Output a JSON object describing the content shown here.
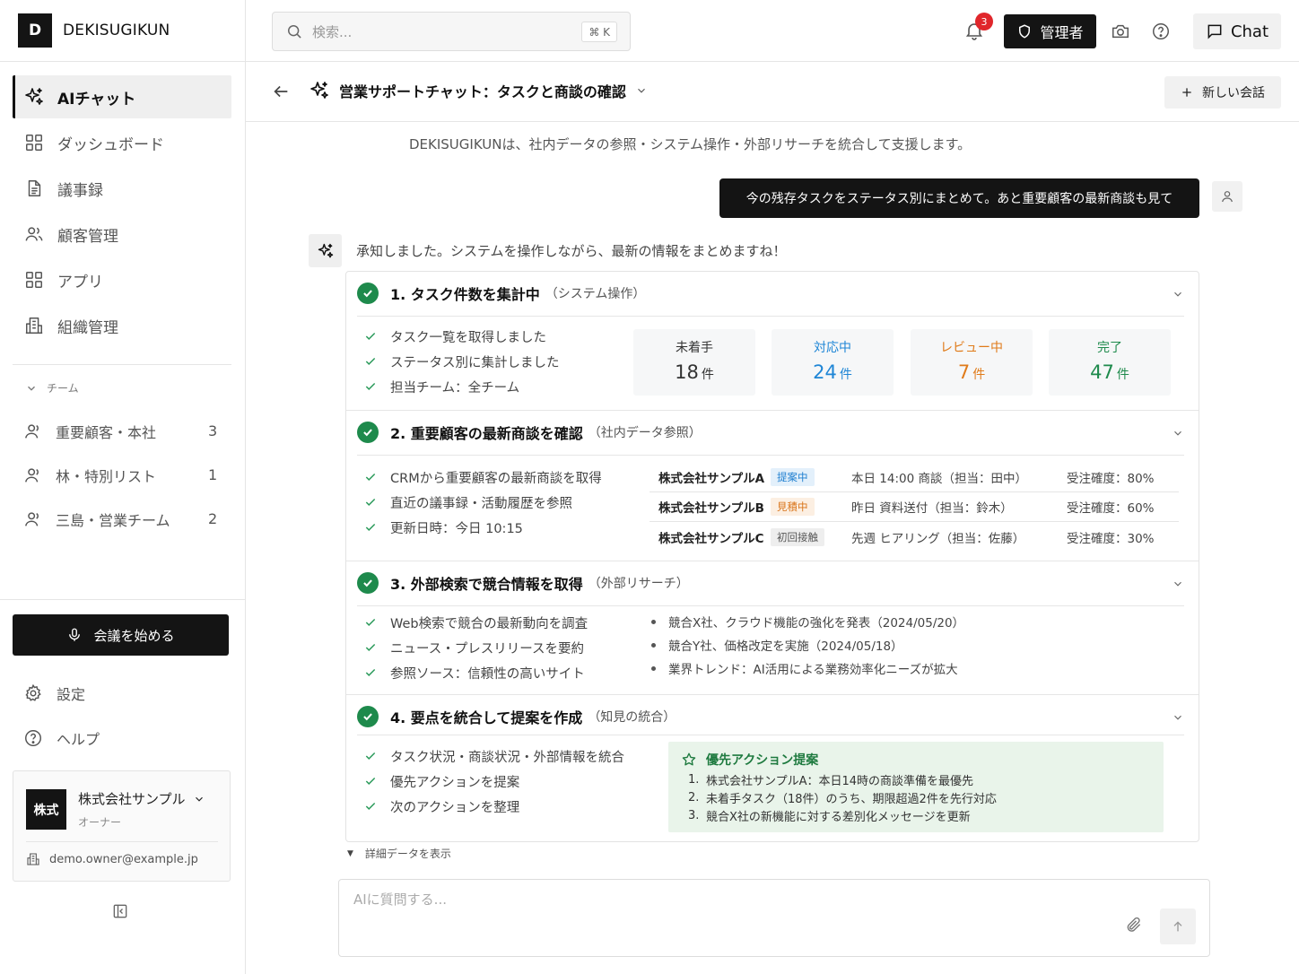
{
  "brand": {
    "logo_letter": "D",
    "name": "DEKISUGIKUN"
  },
  "sidebar": {
    "nav": [
      {
        "label": "AIチャット",
        "icon": "sparkle-icon",
        "active": true
      },
      {
        "label": "ダッシュボード",
        "icon": "grid-icon"
      },
      {
        "label": "議事録",
        "icon": "document-icon"
      },
      {
        "label": "顧客管理",
        "icon": "users-icon"
      },
      {
        "label": "アプリ",
        "icon": "apps-icon"
      },
      {
        "label": "組織管理",
        "icon": "building-icon"
      }
    ],
    "team_header": "チーム",
    "teams": [
      {
        "label": "重要顧客・本社",
        "count": "3"
      },
      {
        "label": "林・特別リスト",
        "count": "1"
      },
      {
        "label": "三島・営業チーム",
        "count": "2"
      }
    ],
    "meeting_button": "会議を始める",
    "settings": "設定",
    "help": "ヘルプ",
    "account": {
      "logo": "株式",
      "name": "株式会社サンプル",
      "role": "オーナー",
      "email": "demo.owner@example.jp"
    }
  },
  "topbar": {
    "search_placeholder": "検索...",
    "search_shortcut": "⌘ K",
    "notification_count": "3",
    "admin_label": "管理者",
    "chat_label": "Chat"
  },
  "chat": {
    "title": "営業サポートチャット：タスクと商談の確認",
    "new_chat": "新しい会話",
    "intro": "DEKISUGIKUNは、社内データの参照・システム操作・外部リサーチを統合して支援します。",
    "user_message": "今の残存タスクをステータス別にまとめて。あと重要顧客の最新商談も見て",
    "ai_message": "承知しました。システムを操作しながら、最新の情報をまとめますね！",
    "steps": [
      {
        "title": "1. タスク件数を集計中",
        "sub": "（システム操作）",
        "bullets": [
          "タスク一覧を取得しました",
          "ステータス別に集計しました",
          "担当チーム：全チーム"
        ]
      },
      {
        "title": "2. 重要顧客の最新商談を確認",
        "sub": "（社内データ参照）",
        "bullets": [
          "CRMから重要顧客の最新商談を取得",
          "直近の議事録・活動履歴を参照",
          "更新日時：今日 10:15"
        ]
      },
      {
        "title": "3. 外部検索で競合情報を取得",
        "sub": "（外部リサーチ）",
        "bullets": [
          "Web検索で競合の最新動向を調査",
          "ニュース・プレスリリースを要約",
          "参照ソース：信頼性の高いサイト"
        ]
      },
      {
        "title": "4. 要点を統合して提案を作成",
        "sub": "（知見の統合）",
        "bullets": [
          "タスク状況・商談状況・外部情報を統合",
          "優先アクションを提案",
          "次のアクションを整理"
        ]
      }
    ],
    "task_stats": [
      {
        "label": "未着手",
        "value": "18",
        "unit": "件",
        "color": "#333333"
      },
      {
        "label": "対応中",
        "value": "24",
        "unit": "件",
        "color": "#1f86d6"
      },
      {
        "label": "レビュー中",
        "value": "7",
        "unit": "件",
        "color": "#e07b1a"
      },
      {
        "label": "完了",
        "value": "47",
        "unit": "件",
        "color": "#1e8a4c"
      }
    ],
    "deals": [
      {
        "company": "株式会社サンプルA",
        "tag": "提案中",
        "tag_color": "#1f7fd0",
        "tag_bg": "#e3f0fb",
        "activity": "本日 14:00 商談（担当：田中）",
        "probability": "受注確度：80%"
      },
      {
        "company": "株式会社サンプルB",
        "tag": "見積中",
        "tag_color": "#d9741a",
        "tag_bg": "#fcefe2",
        "activity": "昨日 資料送付（担当：鈴木）",
        "probability": "受注確度：60%"
      },
      {
        "company": "株式会社サンプルC",
        "tag": "初回接触",
        "tag_color": "#555555",
        "tag_bg": "#eeeeee",
        "activity": "先週 ヒアリング（担当：佐藤）",
        "probability": "受注確度：30%"
      }
    ],
    "news": [
      "競合X社、クラウド機能の強化を発表（2024/05/20）",
      "競合Y社、価格改定を実施（2024/05/18）",
      "業界トレンド：AI活用による業務効率化ニーズが拡大"
    ],
    "proposal": {
      "title": "優先アクション提案",
      "items": [
        {
          "num": "1.",
          "text": "株式会社サンプルA：本日14時の商談準備を最優先"
        },
        {
          "num": "2.",
          "text": "未着手タスク（18件）のうち、期限超過2件を先行対応"
        },
        {
          "num": "3.",
          "text": "競合X社の新機能に対する差別化メッセージを更新"
        }
      ]
    },
    "detail_toggle": "詳細データを表示",
    "input_placeholder": "AIに質問する..."
  }
}
